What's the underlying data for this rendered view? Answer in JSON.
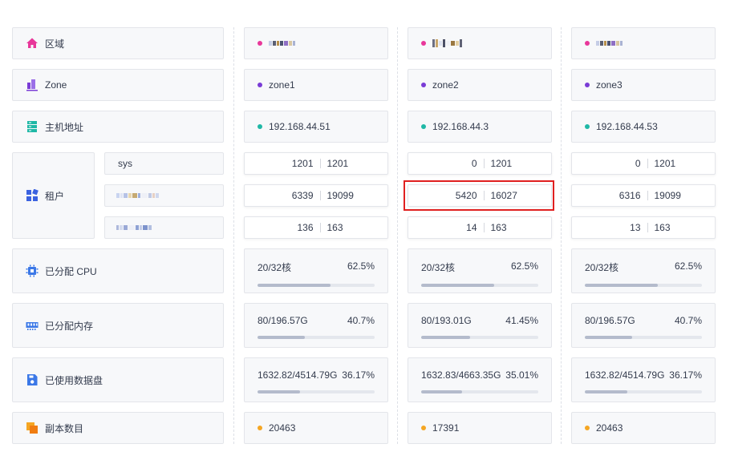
{
  "labels": {
    "region": "区域",
    "zone": "Zone",
    "host": "主机地址",
    "tenant": "租户",
    "tenant_sys": "sys",
    "cpu": "已分配 CPU",
    "memory": "已分配内存",
    "disk": "已使用数据盘",
    "replica": "副本数目"
  },
  "icons": {
    "region": "home-icon",
    "zone": "chart-icon",
    "host": "server-icon",
    "tenant": "grid-icon",
    "cpu": "cpu-icon",
    "memory": "memory-icon",
    "disk": "save-icon",
    "replica": "copy-icon"
  },
  "colors": {
    "region_dot": "#e8379a",
    "zone_dot": "#7a3cd6",
    "host_dot": "#1fb8a6",
    "replica_dot": "#f5a623",
    "highlight": "#e02020"
  },
  "columns": [
    {
      "zone": "zone1",
      "host": "192.168.44.51",
      "tenants": [
        {
          "left": "1201",
          "right": "1201"
        },
        {
          "left": "6339",
          "right": "19099"
        },
        {
          "left": "136",
          "right": "163"
        }
      ],
      "cpu": {
        "text": "20/32核",
        "percent": "62.5%",
        "ratio": 0.625
      },
      "memory": {
        "text": "80/196.57G",
        "percent": "40.7%",
        "ratio": 0.407
      },
      "disk": {
        "text": "1632.82/4514.79G",
        "percent": "36.17%",
        "ratio": 0.3617
      },
      "replica": "20463"
    },
    {
      "zone": "zone2",
      "host": "192.168.44.3",
      "tenants": [
        {
          "left": "0",
          "right": "1201"
        },
        {
          "left": "5420",
          "right": "16027"
        },
        {
          "left": "14",
          "right": "163"
        }
      ],
      "cpu": {
        "text": "20/32核",
        "percent": "62.5%",
        "ratio": 0.625
      },
      "memory": {
        "text": "80/193.01G",
        "percent": "41.45%",
        "ratio": 0.4145
      },
      "disk": {
        "text": "1632.83/4663.35G",
        "percent": "35.01%",
        "ratio": 0.3501
      },
      "replica": "17391"
    },
    {
      "zone": "zone3",
      "host": "192.168.44.53",
      "tenants": [
        {
          "left": "0",
          "right": "1201"
        },
        {
          "left": "6316",
          "right": "19099"
        },
        {
          "left": "13",
          "right": "163"
        }
      ],
      "cpu": {
        "text": "20/32核",
        "percent": "62.5%",
        "ratio": 0.625
      },
      "memory": {
        "text": "80/196.57G",
        "percent": "40.7%",
        "ratio": 0.407
      },
      "disk": {
        "text": "1632.82/4514.79G",
        "percent": "36.17%",
        "ratio": 0.3617
      },
      "replica": "20463"
    }
  ]
}
